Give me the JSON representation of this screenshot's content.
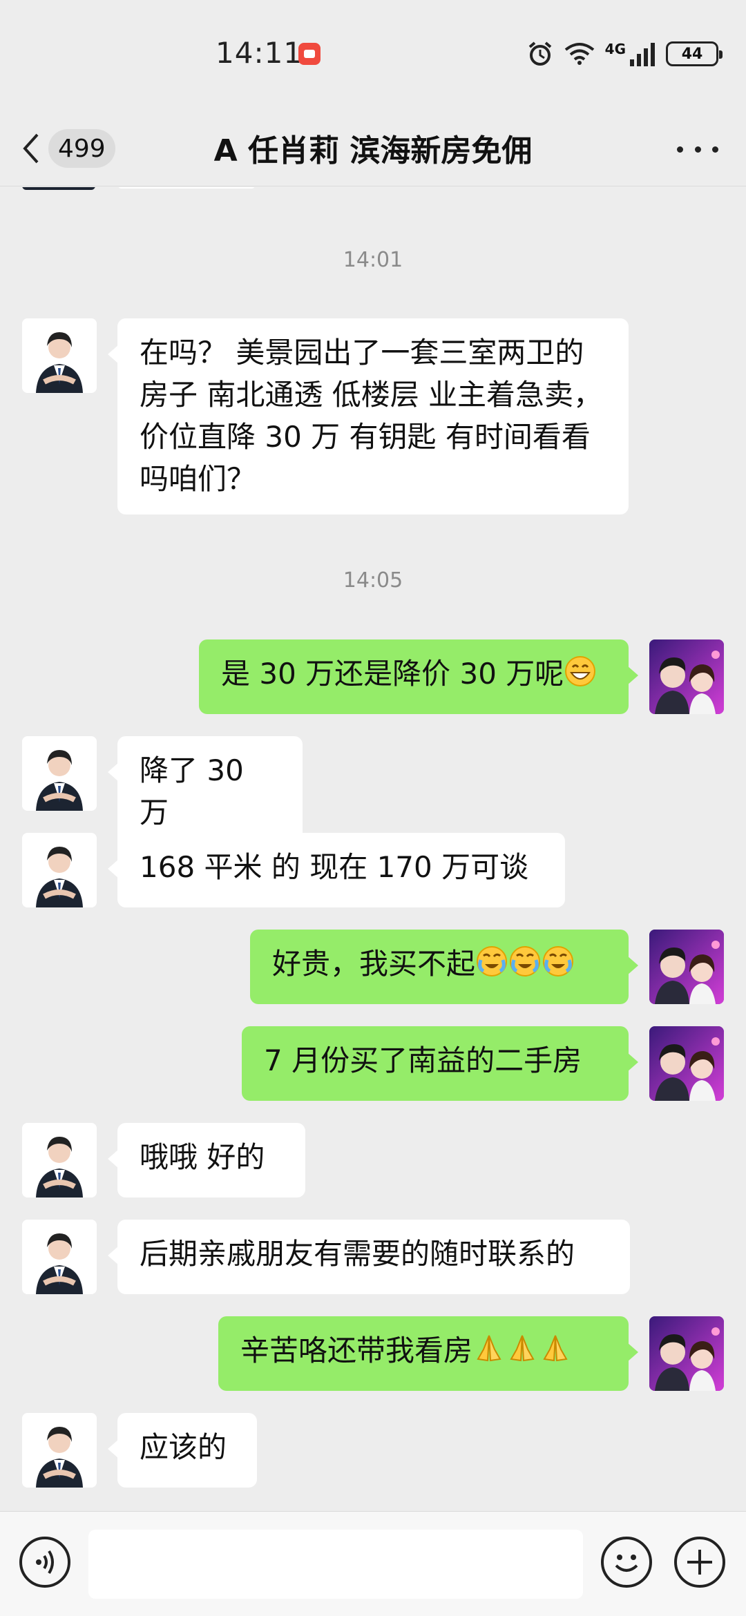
{
  "status_bar": {
    "time": "14:11",
    "network": "4G",
    "battery": "44"
  },
  "nav": {
    "unread_count": "499",
    "title": "A 任肖莉  滨海新房免佣"
  },
  "messages": [
    {
      "kind": "timestamp",
      "text": "14:01"
    },
    {
      "kind": "incoming",
      "text": "在吗？ 美景园出了一套三室两卫的房子  南北通透  低楼层 业主着急卖，价位直降 30 万  有钥匙  有时间看看吗咱们？"
    },
    {
      "kind": "timestamp",
      "text": "14:05"
    },
    {
      "kind": "outgoing",
      "text": "是 30 万还是降价 30 万呢",
      "emoji": [
        "grin"
      ]
    },
    {
      "kind": "incoming",
      "text": "降了 30 万"
    },
    {
      "kind": "incoming",
      "text": "168 平米 的  现在 170 万可谈"
    },
    {
      "kind": "outgoing",
      "text": "好贵，我买不起",
      "emoji": [
        "cry",
        "cry",
        "cry"
      ]
    },
    {
      "kind": "outgoing",
      "text": "7 月份买了南益的二手房"
    },
    {
      "kind": "incoming",
      "text": "哦哦  好的"
    },
    {
      "kind": "incoming",
      "text": "后期亲戚朋友有需要的随时联系的"
    },
    {
      "kind": "outgoing",
      "text": "辛苦咯还带我看房",
      "emoji": [
        "pray",
        "pray",
        "pray"
      ]
    },
    {
      "kind": "incoming",
      "text": "应该的"
    }
  ],
  "input": {
    "placeholder": ""
  },
  "colors": {
    "background": "#EDEDED",
    "outgoing_bubble": "#95EC69",
    "incoming_bubble": "#FFFFFF"
  }
}
